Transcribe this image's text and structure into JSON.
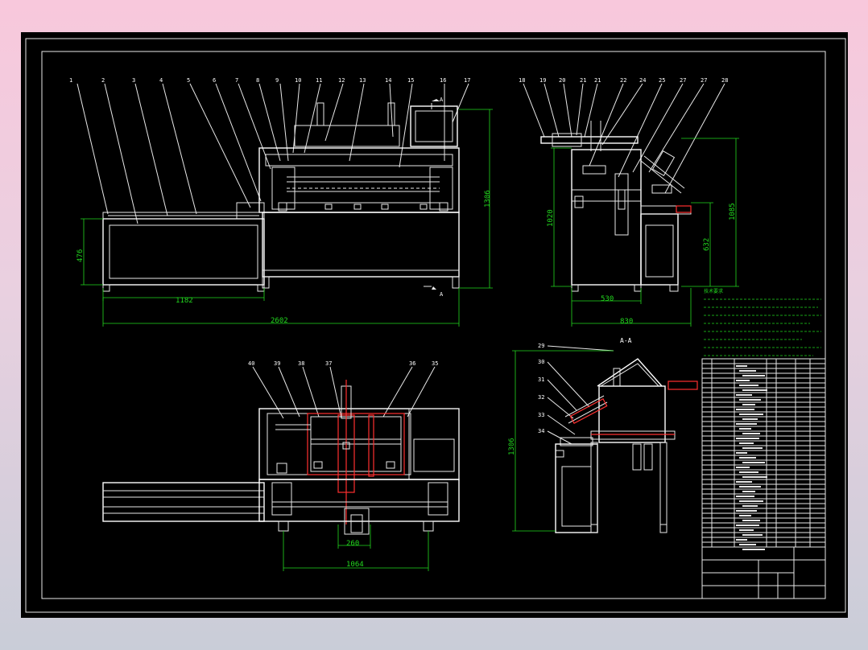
{
  "drawing": {
    "front_view": {
      "part_numbers": [
        "1",
        "2",
        "3",
        "4",
        "5",
        "6",
        "7",
        "8",
        "9",
        "10",
        "11",
        "12",
        "13",
        "14",
        "15",
        "16",
        "17"
      ],
      "dimensions": {
        "width_left": "1182",
        "overall_width": "2602",
        "height_left": "476",
        "height_right": "1306"
      },
      "section_marks": [
        "A",
        "A"
      ]
    },
    "side_view": {
      "part_numbers": [
        "18",
        "19",
        "20",
        "21",
        "21",
        "22",
        "24",
        "25",
        "27",
        "27",
        "28"
      ],
      "dimensions": {
        "height": "1020",
        "overall_height": "1085",
        "table_height": "632",
        "width": "530",
        "overall_width": "830"
      }
    },
    "top_view": {
      "part_numbers": [
        "40",
        "39",
        "38",
        "37",
        "36",
        "35"
      ],
      "dimensions": {
        "inner": "260",
        "overall": "1064"
      }
    },
    "section_view": {
      "title": "A-A",
      "part_numbers": [
        "29",
        "30",
        "31",
        "32",
        "33",
        "34"
      ],
      "dimensions": {
        "height": "1306"
      }
    },
    "notes_title": "技术要求"
  },
  "colors": {
    "lines": "#e8e8e8",
    "dimensions": "#22d81e",
    "highlight": "#ff3030",
    "sheet": "#000000"
  }
}
